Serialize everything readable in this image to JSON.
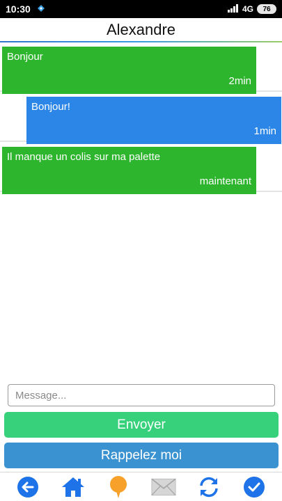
{
  "status_bar": {
    "time": "10:30",
    "network": "4G",
    "battery": "76"
  },
  "header": {
    "title": "Alexandre"
  },
  "messages": [
    {
      "text": "Bonjour",
      "time": "2min",
      "direction": "incoming"
    },
    {
      "text": "Bonjour!",
      "time": "1min",
      "direction": "outgoing"
    },
    {
      "text": "Il manque un colis sur ma palette",
      "time": "maintenant",
      "direction": "incoming"
    }
  ],
  "composer": {
    "placeholder": "Message...",
    "send_label": "Envoyer",
    "callback_label": "Rappelez moi"
  },
  "bottom_nav": {
    "icons": [
      "back-arrow-icon",
      "home-icon",
      "chat-bubble-icon",
      "mail-icon",
      "refresh-icon",
      "check-icon"
    ]
  },
  "colors": {
    "incoming_bubble": "#2db52d",
    "outgoing_bubble": "#2b86e8",
    "send_button": "#36d17a",
    "callback_button": "#3a93d0",
    "nav_blue": "#1e73e8",
    "nav_orange": "#f7a02a"
  }
}
